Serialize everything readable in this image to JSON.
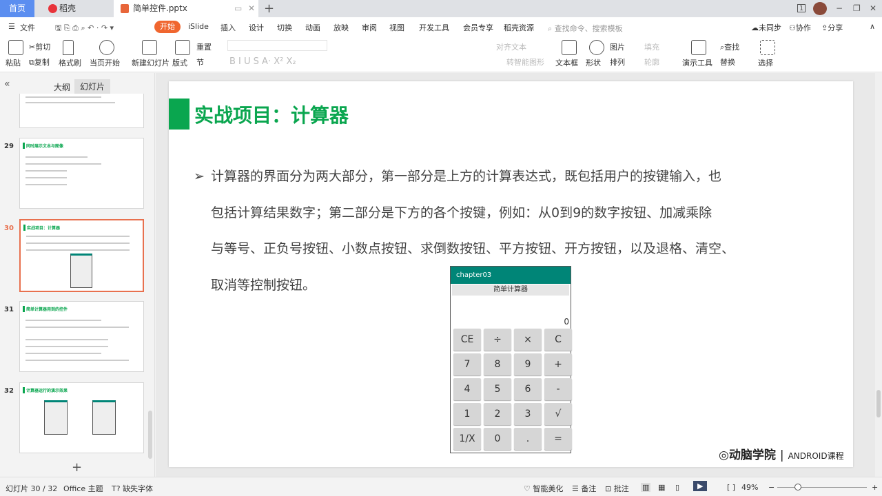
{
  "tabs": {
    "home": "首页",
    "daoke": "稻壳",
    "file": "简单控件.pptx",
    "add": "+"
  },
  "window": {
    "badge": "1",
    "minimize": "−",
    "restore": "❐",
    "close": "✕"
  },
  "menu": {
    "file": "文件",
    "items": [
      "开始",
      "iSlide",
      "插入",
      "设计",
      "切换",
      "动画",
      "放映",
      "审阅",
      "视图",
      "开发工具",
      "会员专享",
      "稻壳资源"
    ],
    "search": "查找命令、搜索模板",
    "sync": "未同步",
    "collab": "协作",
    "share": "分享"
  },
  "ribbon": {
    "paste": "粘贴",
    "cut": "剪切",
    "copy": "复制",
    "format_painter": "格式刷",
    "play_from": "当页开始",
    "new_slide": "新建幻灯片",
    "layout": "版式",
    "reset": "重置",
    "section": "节",
    "align_text": "对齐文本",
    "smart_art": "转智能图形",
    "textbox": "文本框",
    "shape": "形状",
    "picture": "图片",
    "fill": "填充",
    "arrange": "排列",
    "outline": "轮廓",
    "present_tools": "演示工具",
    "find": "查找",
    "replace": "替换",
    "select": "选择"
  },
  "sidebar": {
    "tab_outline": "大纲",
    "tab_slides": "幻灯片",
    "collapse": "«",
    "add": "+",
    "thumbs": [
      {
        "num": "29",
        "title": "同时展示文本与图像"
      },
      {
        "num": "30",
        "title": "实战项目：计算器"
      },
      {
        "num": "31",
        "title": "简单计算器用到的控件"
      },
      {
        "num": "32",
        "title": "计算器运行的演示效果"
      }
    ]
  },
  "slide": {
    "title": "实战项目：计算器",
    "bullet": "➢",
    "lines": [
      "计算器的界面分为两大部分，第一部分是上方的计算表达式，既包括用户的按键输入，也",
      "包括计算结果数字；第二部分是下方的各个按键，例如：从0到9的数字按钮、加减乘除",
      "与等号、正负号按钮、小数点按钮、求倒数按钮、平方按钮、开方按钮，以及退格、清空、",
      "取消等控制按钮。"
    ],
    "calc": {
      "app": "chapter03",
      "title": "简单计算器",
      "display": "0",
      "buttons": [
        "CE",
        "÷",
        "×",
        "C",
        "7",
        "8",
        "9",
        "+",
        "4",
        "5",
        "6",
        "-",
        "1",
        "2",
        "3",
        "√",
        "1/X",
        "0",
        ".",
        "="
      ]
    },
    "logo": "动脑学院",
    "logo_sub": "ANDROID课程"
  },
  "status": {
    "slide": "幻灯片 30 / 32",
    "theme": "Office 主题",
    "font": "缺失字体",
    "beautify": "智能美化",
    "notes": "备注",
    "comment": "批注",
    "zoom": "49%"
  },
  "colors": {
    "accent": "#0aa64f",
    "start": "#f0662f",
    "calc_header": "#008577"
  }
}
